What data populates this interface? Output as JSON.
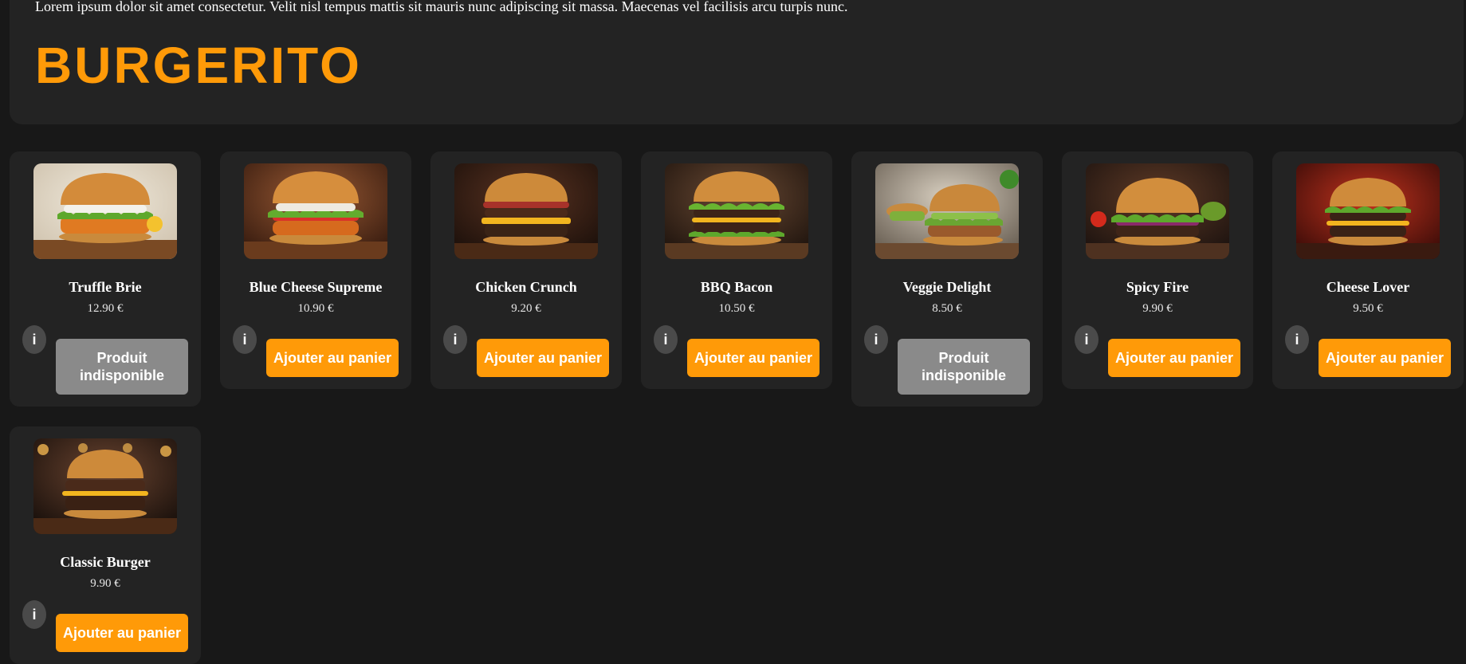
{
  "header": {
    "intro": "Lorem ipsum dolor sit amet consectetur. Velit nisl tempus mattis sit mauris nunc adipiscing sit massa. Maecenas vel facilisis arcu turpis nunc.",
    "brand": "BURGERITO"
  },
  "products": [
    {
      "name": "Truffle Brie",
      "price": "12.90 €",
      "info": "i",
      "button": "Produit indisponible",
      "available": false
    },
    {
      "name": "Blue Cheese Supreme",
      "price": "10.90 €",
      "info": "i",
      "button": "Ajouter au panier",
      "available": true
    },
    {
      "name": "Chicken Crunch",
      "price": "9.20 €",
      "info": "i",
      "button": "Ajouter au panier",
      "available": true
    },
    {
      "name": "BBQ Bacon",
      "price": "10.50 €",
      "info": "i",
      "button": "Ajouter au panier",
      "available": true
    },
    {
      "name": "Veggie Delight",
      "price": "8.50 €",
      "info": "i",
      "button": "Produit indisponible",
      "available": false
    },
    {
      "name": "Spicy Fire",
      "price": "9.90 €",
      "info": "i",
      "button": "Ajouter au panier",
      "available": true
    },
    {
      "name": "Cheese Lover",
      "price": "9.50 €",
      "info": "i",
      "button": "Ajouter au panier",
      "available": true
    },
    {
      "name": "Classic Burger",
      "price": "9.90 €",
      "info": "i",
      "button": "Ajouter au panier",
      "available": true
    }
  ],
  "colors": {
    "accent": "#ff9a08",
    "unavailable": "#8a8a8a",
    "card": "#232323",
    "page": "#181818"
  }
}
